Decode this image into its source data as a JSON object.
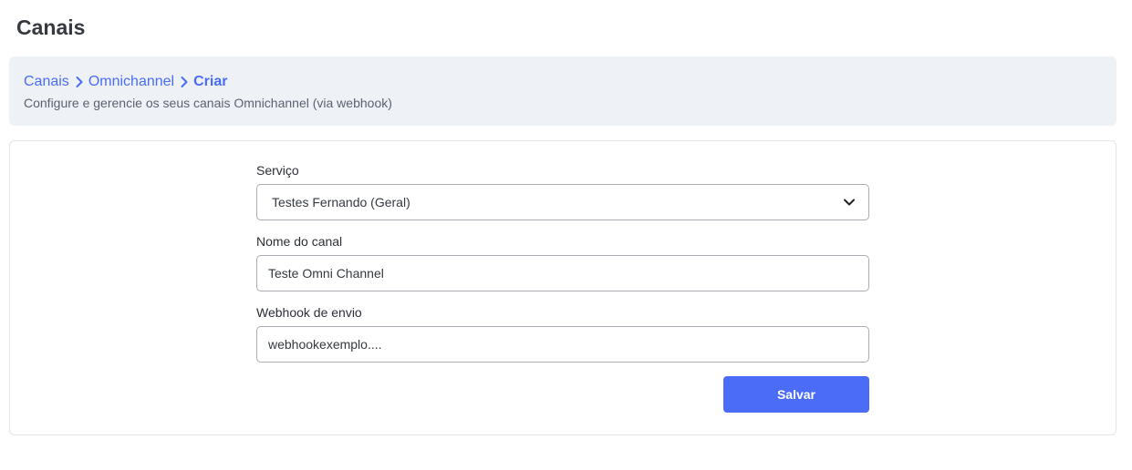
{
  "page": {
    "title": "Canais"
  },
  "header": {
    "breadcrumb": {
      "items": [
        "Canais",
        "Omnichannel"
      ],
      "current": "Criar",
      "separator_icon": "chevron-right-icon"
    },
    "subtitle": "Configure e gerencie os seus canais Omnichannel (via webhook)"
  },
  "form": {
    "service": {
      "label": "Serviço",
      "selected": "Testes Fernando (Geral)",
      "icon": "chevron-down-icon"
    },
    "channel_name": {
      "label": "Nome do canal",
      "value": "Teste Omni Channel"
    },
    "webhook": {
      "label": "Webhook de envio",
      "value": "webhookexemplo...."
    },
    "save_label": "Salvar"
  },
  "colors": {
    "accent": "#4a6cf7",
    "header_bg": "#eef1f6",
    "border": "#a9adb3"
  }
}
